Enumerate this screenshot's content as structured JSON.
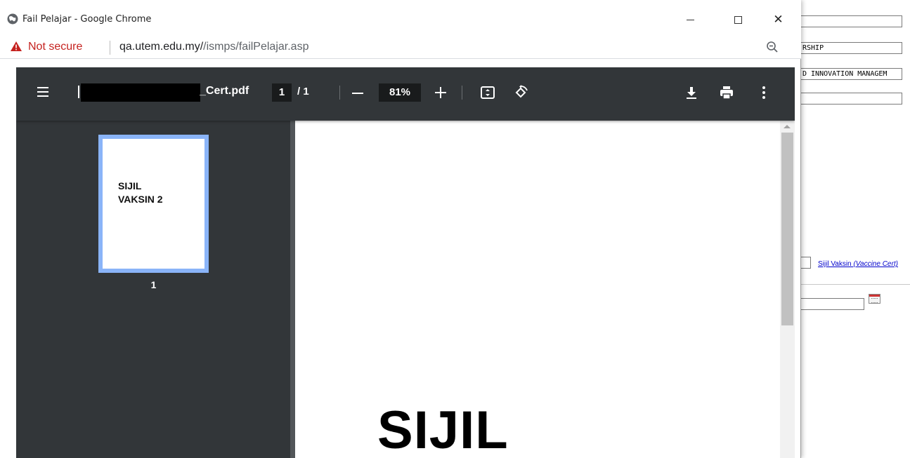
{
  "background_page": {
    "field_1": "",
    "field_2": "RSHIP",
    "field_3": "D INNOVATION MANAGEM",
    "field_4": "",
    "link_main": "Sijil Vaksin ",
    "link_italic": "(Vaccine Cert)",
    "date_field": ""
  },
  "window": {
    "title": "Fail Pelajar - Google Chrome",
    "minimize_icon": "minimize-icon",
    "maximize_icon": "maximize-icon",
    "close_icon": "close-icon",
    "close_glyph": "✕"
  },
  "address_bar": {
    "security_label": "Not secure",
    "url_host": "qa.utem.edu.my/",
    "url_path": "/ismps/failPelajar.asp",
    "warning_color": "#c5221f"
  },
  "pdf_viewer": {
    "filename": "_Cert.pdf",
    "current_page": "1",
    "total_pages": "/ 1",
    "zoom": "81%",
    "thumbnail_text_line1": "SIJIL",
    "thumbnail_text_line2": "VAKSIN 2",
    "thumbnail_page_number": "1",
    "page_heading": "SIJIL",
    "accent_color": "#8ab4f8",
    "toolbar_color": "#323639"
  }
}
